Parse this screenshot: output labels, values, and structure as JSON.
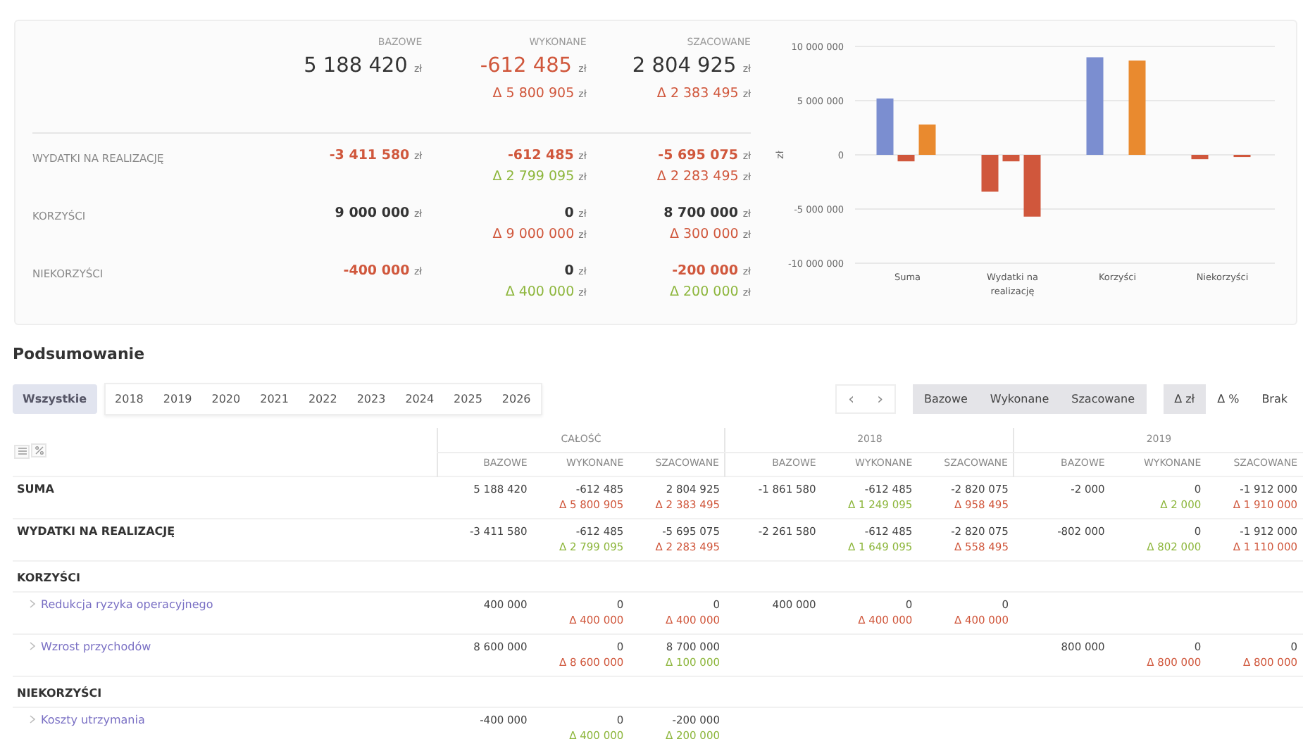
{
  "overview": {
    "columns": [
      "BAZOWE",
      "WYKONANE",
      "SZACOWANE"
    ],
    "total": {
      "cells": [
        {
          "amount": "5 188 420",
          "unit": "zł"
        },
        {
          "amount": "-612 485",
          "unit": "zł",
          "color": "#d0573c",
          "delta": {
            "text": "Δ 5 800 905",
            "unit": "zł",
            "color": "#d0573c"
          }
        },
        {
          "amount": "2 804 925",
          "unit": "zł",
          "delta": {
            "text": "Δ 2 383 495",
            "unit": "zł",
            "color": "#d0573c"
          }
        }
      ]
    },
    "rows": [
      {
        "label": "WYDATKI NA REALIZACJĘ",
        "cells": [
          {
            "amount": "-3 411 580",
            "unit": "zł",
            "color": "#d0573c"
          },
          {
            "amount": "-612 485",
            "unit": "zł",
            "color": "#d0573c",
            "delta": {
              "text": "Δ 2 799 095",
              "unit": "zł",
              "color": "#8db63c"
            }
          },
          {
            "amount": "-5 695 075",
            "unit": "zł",
            "color": "#d0573c",
            "delta": {
              "text": "Δ 2 283 495",
              "unit": "zł",
              "color": "#d0573c"
            }
          }
        ]
      },
      {
        "label": "KORZYŚCI",
        "cells": [
          {
            "amount": "9 000 000",
            "unit": "zł"
          },
          {
            "amount": "0",
            "unit": "zł",
            "delta": {
              "text": "Δ 9 000 000",
              "unit": "zł",
              "color": "#d0573c"
            }
          },
          {
            "amount": "8 700 000",
            "unit": "zł",
            "delta": {
              "text": "Δ 300 000",
              "unit": "zł",
              "color": "#d0573c"
            }
          }
        ]
      },
      {
        "label": "NIEKORZYŚCI",
        "cells": [
          {
            "amount": "-400 000",
            "unit": "zł",
            "color": "#d0573c"
          },
          {
            "amount": "0",
            "unit": "zł",
            "delta": {
              "text": "Δ 400 000",
              "unit": "zł",
              "color": "#8db63c"
            }
          },
          {
            "amount": "-200 000",
            "unit": "zł",
            "color": "#d0573c",
            "delta": {
              "text": "Δ 200 000",
              "unit": "zł",
              "color": "#8db63c"
            }
          }
        ]
      }
    ],
    "chart_data": {
      "type": "bar",
      "ylabel": "zł",
      "grid": true,
      "categories": [
        "Suma",
        "Wydatki na realizację",
        "Korzyści",
        "Niekorzyści"
      ],
      "series": [
        {
          "color": "#7b8ed0",
          "values": [
            5200000,
            null,
            9000000,
            null
          ]
        },
        {
          "color": "#d0573c",
          "values": [
            null,
            -3400000,
            null,
            -400000
          ]
        },
        {
          "color": "#d0573c",
          "values": [
            -600000,
            -600000,
            0,
            0
          ]
        },
        {
          "color": "#e98a2f",
          "values": [
            2800000,
            null,
            8700000,
            null
          ]
        },
        {
          "color": "#d0573c",
          "values": [
            null,
            -5700000,
            null,
            -200000
          ]
        }
      ],
      "ylim": [
        -10000000,
        10000000
      ],
      "yticks": [
        {
          "value": -10000000,
          "label": "-10 000 000"
        },
        {
          "value": -5000000,
          "label": "-5 000 000"
        },
        {
          "value": 0,
          "label": "0"
        },
        {
          "value": 5000000,
          "label": "5 000 000"
        },
        {
          "value": 10000000,
          "label": "10 000 000"
        }
      ]
    }
  },
  "summary": {
    "title": "Podsumowanie",
    "period_tabs": [
      {
        "label": "Wszystkie",
        "selected": true
      },
      {
        "label": "2018",
        "selected": false
      },
      {
        "label": "2019",
        "selected": false
      },
      {
        "label": "2020",
        "selected": false
      },
      {
        "label": "2021",
        "selected": false
      },
      {
        "label": "2022",
        "selected": false
      },
      {
        "label": "2023",
        "selected": false
      },
      {
        "label": "2024",
        "selected": false
      },
      {
        "label": "2025",
        "selected": false
      },
      {
        "label": "2026",
        "selected": false
      }
    ],
    "pager": [
      "‹",
      "›"
    ],
    "value_toggles": [
      {
        "label": "Bazowe",
        "selected": true
      },
      {
        "label": "Wykonane",
        "selected": true
      },
      {
        "label": "Szacowane",
        "selected": true
      }
    ],
    "delta_toggles": [
      {
        "label": "Δ zł",
        "selected": true
      },
      {
        "label": "Δ %",
        "selected": false
      },
      {
        "label": "Brak",
        "selected": false
      }
    ],
    "table": {
      "groups": [
        "CAŁOŚĆ",
        "2018",
        "2019"
      ],
      "columns": [
        "BAZOWE",
        "WYKONANE",
        "SZACOWANE",
        "BAZOWE",
        "WYKONANE",
        "SZACOWANE",
        "BAZOWE",
        "WYKONANE",
        "SZACOWANE"
      ],
      "rows": [
        {
          "kind": "total",
          "label": "SUMA",
          "cells": [
            {
              "value": "5 188 420"
            },
            {
              "value": "-612 485",
              "delta": {
                "text": "Δ 5 800 905",
                "color": "#d0573c"
              }
            },
            {
              "value": "2 804 925",
              "delta": {
                "text": "Δ 2 383 495",
                "color": "#d0573c"
              }
            },
            {
              "value": "-1 861 580"
            },
            {
              "value": "-612 485",
              "delta": {
                "text": "Δ 1 249 095",
                "color": "#8db63c"
              }
            },
            {
              "value": "-2 820 075",
              "delta": {
                "text": "Δ 958 495",
                "color": "#d0573c"
              }
            },
            {
              "value": "-2 000"
            },
            {
              "value": "0",
              "delta": {
                "text": "Δ 2 000",
                "color": "#8db63c"
              }
            },
            {
              "value": "-1 912 000",
              "delta": {
                "text": "Δ 1 910 000",
                "color": "#d0573c"
              }
            }
          ]
        },
        {
          "kind": "total",
          "label": "WYDATKI NA REALIZACJĘ",
          "cells": [
            {
              "value": "-3 411 580"
            },
            {
              "value": "-612 485",
              "delta": {
                "text": "Δ 2 799 095",
                "color": "#8db63c"
              }
            },
            {
              "value": "-5 695 075",
              "delta": {
                "text": "Δ 2 283 495",
                "color": "#d0573c"
              }
            },
            {
              "value": "-2 261 580"
            },
            {
              "value": "-612 485",
              "delta": {
                "text": "Δ 1 649 095",
                "color": "#8db63c"
              }
            },
            {
              "value": "-2 820 075",
              "delta": {
                "text": "Δ 558 495",
                "color": "#d0573c"
              }
            },
            {
              "value": "-802 000"
            },
            {
              "value": "0",
              "delta": {
                "text": "Δ 802 000",
                "color": "#8db63c"
              }
            },
            {
              "value": "-1 912 000",
              "delta": {
                "text": "Δ 1 110 000",
                "color": "#d0573c"
              }
            }
          ]
        },
        {
          "kind": "section",
          "label": "KORZYŚCI"
        },
        {
          "kind": "item",
          "label": "Redukcja ryzyka operacyjnego",
          "cells": [
            {
              "value": "400 000"
            },
            {
              "value": "0",
              "delta": {
                "text": "Δ 400 000",
                "color": "#d0573c"
              }
            },
            {
              "value": "0",
              "delta": {
                "text": "Δ 400 000",
                "color": "#d0573c"
              }
            },
            {
              "value": "400 000"
            },
            {
              "value": "0",
              "delta": {
                "text": "Δ 400 000",
                "color": "#d0573c"
              }
            },
            {
              "value": "0",
              "delta": {
                "text": "Δ 400 000",
                "color": "#d0573c"
              }
            },
            null,
            null,
            null
          ]
        },
        {
          "kind": "item",
          "label": "Wzrost przychodów",
          "cells": [
            {
              "value": "8 600 000"
            },
            {
              "value": "0",
              "delta": {
                "text": "Δ 8 600 000",
                "color": "#d0573c"
              }
            },
            {
              "value": "8 700 000",
              "delta": {
                "text": "Δ 100 000",
                "color": "#8db63c"
              }
            },
            null,
            null,
            null,
            {
              "value": "800 000"
            },
            {
              "value": "0",
              "delta": {
                "text": "Δ 800 000",
                "color": "#d0573c"
              }
            },
            {
              "value": "0",
              "delta": {
                "text": "Δ 800 000",
                "color": "#d0573c"
              }
            }
          ]
        },
        {
          "kind": "section",
          "label": "NIEKORZYŚCI"
        },
        {
          "kind": "item",
          "label": "Koszty utrzymania",
          "cells": [
            {
              "value": "-400 000"
            },
            {
              "value": "0",
              "delta": {
                "text": "Δ 400 000",
                "color": "#8db63c"
              }
            },
            {
              "value": "-200 000",
              "delta": {
                "text": "Δ 200 000",
                "color": "#8db63c"
              }
            },
            null,
            null,
            null,
            null,
            null,
            null
          ]
        }
      ]
    }
  }
}
